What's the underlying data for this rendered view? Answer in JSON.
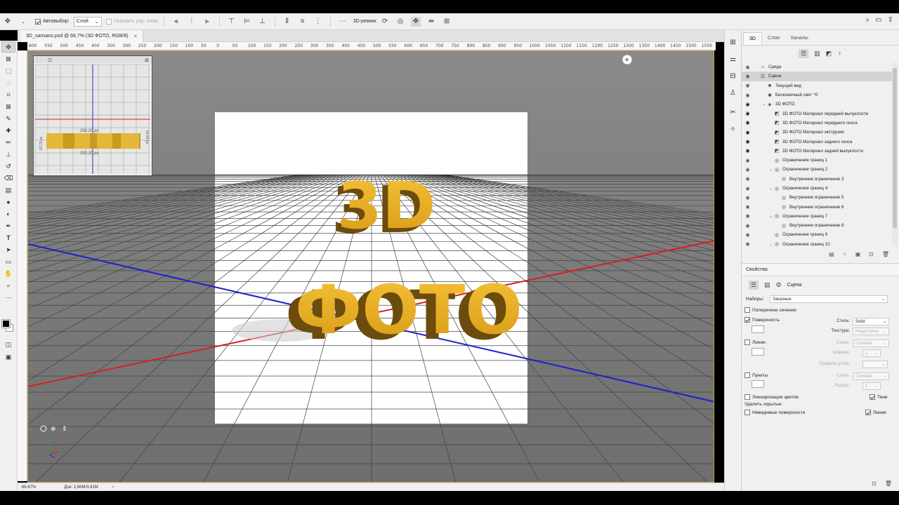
{
  "options_bar": {
    "autoselect_label": "Автовыбор:",
    "autoselect_value": "Слой",
    "show_controls_label": "Показать упр. элем.",
    "mode_3d_label": "3D-режим:"
  },
  "document": {
    "tab_title": "3D_sansans.psd @ 66,7% (3D ФОТО, RGB/8)",
    "tab_close": "×"
  },
  "ruler_ticks": [
    "600",
    "550",
    "500",
    "450",
    "400",
    "350",
    "300",
    "250",
    "200",
    "150",
    "100",
    "50",
    "0",
    "50",
    "100",
    "150",
    "200",
    "250",
    "300",
    "350",
    "400",
    "450",
    "500",
    "550",
    "600",
    "650",
    "700",
    "750",
    "800",
    "850",
    "900",
    "950",
    "1000",
    "1050",
    "1100",
    "1150",
    "1200",
    "1250",
    "1300",
    "1350",
    "1400",
    "1450",
    "1500",
    "1550"
  ],
  "mini_view": {
    "dim_top": "292.20 px",
    "dim_bottom": "292.20 px",
    "dim_left": "63.75 px",
    "dim_right": "63.54 px"
  },
  "canvas_text": {
    "line1": "3D",
    "line2": "ФОТО"
  },
  "status": {
    "zoom": "66,67%",
    "doc": "Док: 2,86M/3,81M",
    "arrow": "›"
  },
  "panel_tabs": [
    "3D",
    "Слои",
    "Каналы"
  ],
  "scene_rows": [
    {
      "label": "Среда",
      "indent": 0,
      "caret": "",
      "icon": "☼",
      "eye": "◉",
      "eye_bold": false,
      "selected": false
    },
    {
      "label": "Сцена",
      "indent": 0,
      "caret": "",
      "icon": "☰",
      "eye": "◉",
      "eye_bold": false,
      "selected": true
    },
    {
      "label": "Текущий вид",
      "indent": 1,
      "caret": "",
      "icon": "■",
      "eye": "◉",
      "eye_bold": false,
      "selected": false
    },
    {
      "label": "Бесконечный свет ^0",
      "indent": 1,
      "caret": "",
      "icon": "✱",
      "eye": "◉",
      "eye_bold": false,
      "selected": false
    },
    {
      "label": "3D ФОТО",
      "indent": 1,
      "caret": "⌄",
      "icon": "◈",
      "eye": "◉",
      "eye_bold": true,
      "selected": false
    },
    {
      "label": "3D ФОТО Материал передней выпуклости",
      "indent": 2,
      "caret": "",
      "icon": "◩",
      "eye": "◉",
      "eye_bold": true,
      "selected": false
    },
    {
      "label": "3D ФОТО Материал переднего скоса",
      "indent": 2,
      "caret": "",
      "icon": "◩",
      "eye": "◉",
      "eye_bold": true,
      "selected": false
    },
    {
      "label": "3D ФОТО Материал экструзии",
      "indent": 2,
      "caret": "",
      "icon": "◩",
      "eye": "◉",
      "eye_bold": true,
      "selected": false
    },
    {
      "label": "3D ФОТО Материал заднего скоса",
      "indent": 2,
      "caret": "",
      "icon": "◩",
      "eye": "◉",
      "eye_bold": true,
      "selected": false
    },
    {
      "label": "3D ФОТО Материал задней выпуклости",
      "indent": 2,
      "caret": "",
      "icon": "◩",
      "eye": "◉",
      "eye_bold": true,
      "selected": false
    },
    {
      "label": "Ограничение границ 1",
      "indent": 2,
      "caret": "",
      "icon": "◎",
      "eye": "◉",
      "eye_bold": false,
      "selected": false
    },
    {
      "label": "Ограничение границ 2",
      "indent": 2,
      "caret": "⌄",
      "icon": "◎",
      "eye": "◉",
      "eye_bold": false,
      "selected": false
    },
    {
      "label": "Внутреннее ограничение 3",
      "indent": 3,
      "caret": "",
      "icon": "◎",
      "eye": "◉",
      "eye_bold": false,
      "selected": false
    },
    {
      "label": "Ограничение границ 4",
      "indent": 2,
      "caret": "⌄",
      "icon": "◎",
      "eye": "◉",
      "eye_bold": false,
      "selected": false
    },
    {
      "label": "Внутреннее ограничение 5",
      "indent": 3,
      "caret": "",
      "icon": "◎",
      "eye": "◉",
      "eye_bold": false,
      "selected": false
    },
    {
      "label": "Внутреннее ограничение 6",
      "indent": 3,
      "caret": "",
      "icon": "◎",
      "eye": "◉",
      "eye_bold": false,
      "selected": false
    },
    {
      "label": "Ограничение границ 7",
      "indent": 2,
      "caret": "⌄",
      "icon": "◎",
      "eye": "◉",
      "eye_bold": false,
      "selected": false
    },
    {
      "label": "Внутреннее ограничение 8",
      "indent": 3,
      "caret": "",
      "icon": "◎",
      "eye": "◉",
      "eye_bold": false,
      "selected": false
    },
    {
      "label": "Ограничение границ 9",
      "indent": 2,
      "caret": "",
      "icon": "◎",
      "eye": "◉",
      "eye_bold": false,
      "selected": false
    },
    {
      "label": "Ограничение границ 10",
      "indent": 2,
      "caret": "⌄",
      "icon": "◎",
      "eye": "◉",
      "eye_bold": false,
      "selected": false
    }
  ],
  "properties": {
    "title": "Свойства",
    "scene_label": "Сцена",
    "presets_label": "Наборы:",
    "presets_value": "Заказные",
    "cross_section": "Поперечное сечение",
    "surface": "Поверхность",
    "surface_style_label": "Стиль:",
    "surface_style_value": "Solid",
    "texture_label": "Текстура:",
    "texture_value": "Недоступно",
    "lines": "Линии",
    "lines_style_label": "Стиль:",
    "lines_style_value": "Constant",
    "width_label": "Ширина:",
    "width_value": "1",
    "angle_label": "Пределы углов:",
    "points": "Пункты",
    "points_style_label": "Стиль:",
    "points_style_value": "Constant",
    "radius_label": "Радиус:",
    "radius_value": "1",
    "linearize": "Линеаризация цветов",
    "shadows": "Тени",
    "remove_hidden": "Удалить скрытые:",
    "backfaces": "Невидимые поверхности",
    "lines_right": "Линии"
  }
}
